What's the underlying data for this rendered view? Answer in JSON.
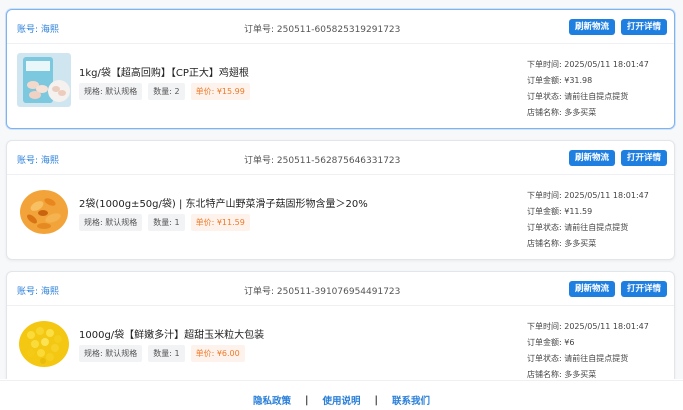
{
  "orders": [
    {
      "account": "账号: 海熙",
      "order_no": "订单号: 250511-605825319291723",
      "refresh_label": "刷新物流",
      "detail_label": "打开详情",
      "product_name": "1kg/袋【超高回购】【CP正大】鸡翅根",
      "spec": "规格: 默认规格",
      "qty": "数量: 2",
      "unit_price": "单价: ¥15.99",
      "order_time": "下单时间: 2025/05/11 18:01:47",
      "amount": "订单金额: ¥31.98",
      "status": "订单状态: 请前往自提点提货",
      "store": "店铺名称: 多多买菜",
      "image_icon": "chicken-wings-image"
    },
    {
      "account": "账号: 海熙",
      "order_no": "订单号: 250511-562875646331723",
      "refresh_label": "刷新物流",
      "detail_label": "打开详情",
      "product_name": "2袋(1000g±50g/袋) | 东北特产山野菜滑子菇固形物含量＞20%",
      "spec": "规格: 默认规格",
      "qty": "数量: 1",
      "unit_price": "单价: ¥11.59",
      "order_time": "下单时间: 2025/05/11 18:01:47",
      "amount": "订单金额: ¥11.59",
      "status": "订单状态: 请前往自提点提货",
      "store": "店铺名称: 多多买菜",
      "image_icon": "mushroom-image"
    },
    {
      "account": "账号: 海熙",
      "order_no": "订单号: 250511-391076954491723",
      "refresh_label": "刷新物流",
      "detail_label": "打开详情",
      "product_name": "1000g/袋【鲜嫩多汁】超甜玉米粒大包装",
      "spec": "规格: 默认规格",
      "qty": "数量: 1",
      "unit_price": "单价: ¥6.00",
      "order_time": "下单时间: 2025/05/11 18:01:47",
      "amount": "订单金额: ¥6",
      "status": "订单状态: 请前往自提点提货",
      "store": "店铺名称: 多多买菜",
      "image_icon": "corn-image"
    }
  ],
  "footer": {
    "privacy": "隐私政策",
    "usage": "使用说明",
    "contact": "联系我们",
    "separator": "|"
  },
  "colors": {
    "accent": "#1f7fe0",
    "link": "#2a7fd9",
    "price": "#f07a2a"
  }
}
